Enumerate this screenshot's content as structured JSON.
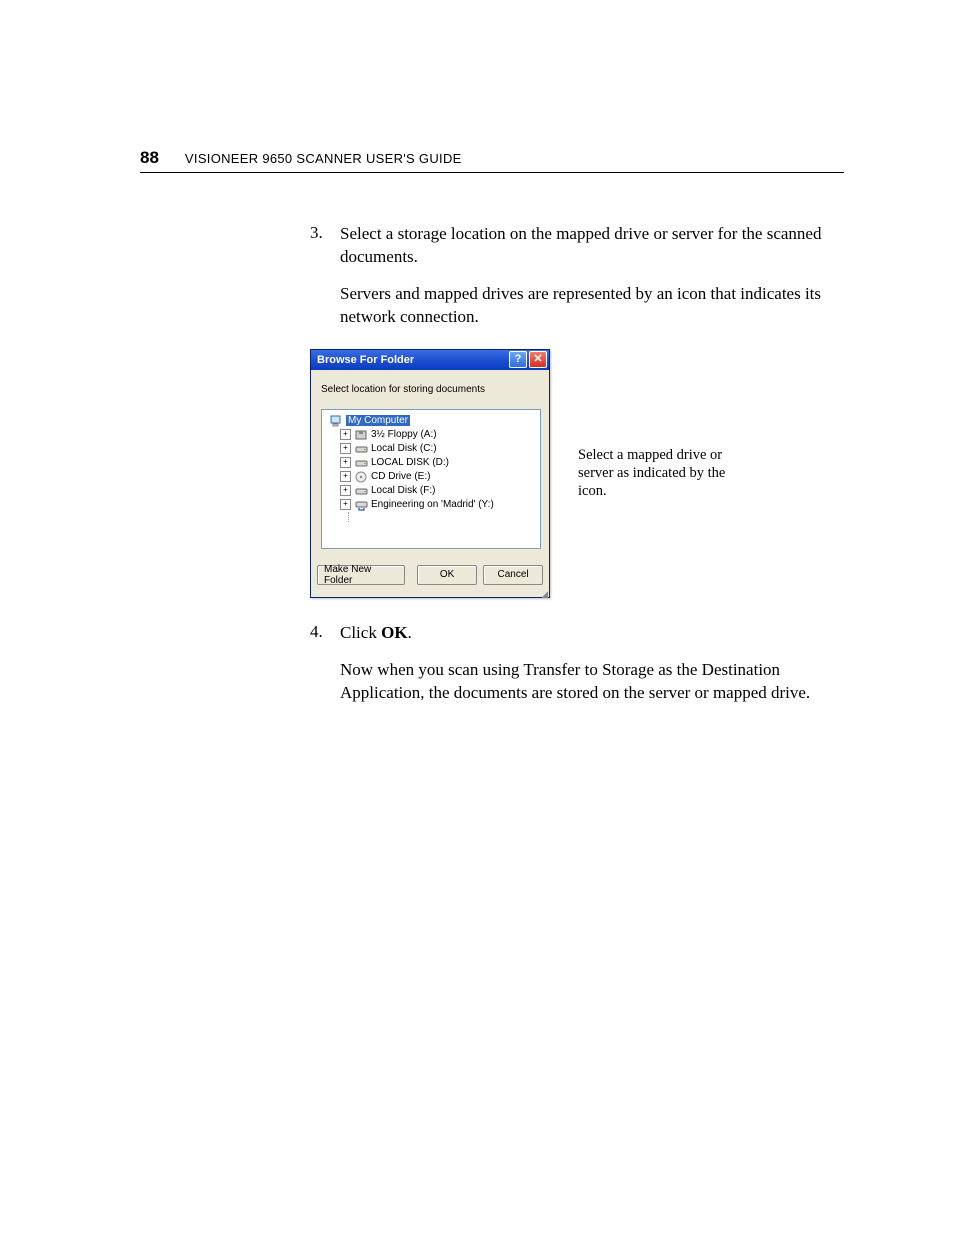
{
  "header": {
    "page_number": "88",
    "title_pre": "V",
    "title_rest": "ISIONEER 9650 SCANNER USER'S GUIDE"
  },
  "step3": {
    "num": "3.",
    "text": "Select a storage location on the mapped drive or server for the scanned documents."
  },
  "step3_para": "Servers and mapped drives are represented by an icon that indicates its network connection.",
  "dialog": {
    "title": "Browse For Folder",
    "help": "?",
    "close": "✕",
    "instruction": "Select location for storing documents",
    "tree": {
      "root": "My Computer",
      "items": [
        "3½ Floppy (A:)",
        "Local Disk (C:)",
        "LOCAL DISK (D:)",
        "CD Drive (E:)",
        "Local Disk (F:)",
        "Engineering on 'Madrid' (Y:)"
      ]
    },
    "buttons": {
      "new": "Make New Folder",
      "ok": "OK",
      "cancel": "Cancel"
    }
  },
  "callout": "Select a mapped drive or server as indicated by the icon.",
  "step4": {
    "num": "4.",
    "pre": "Click ",
    "bold": "OK",
    "post": "."
  },
  "step4_para": "Now when you scan using Transfer to Storage as the Destination Application, the documents are stored on the server or mapped drive."
}
